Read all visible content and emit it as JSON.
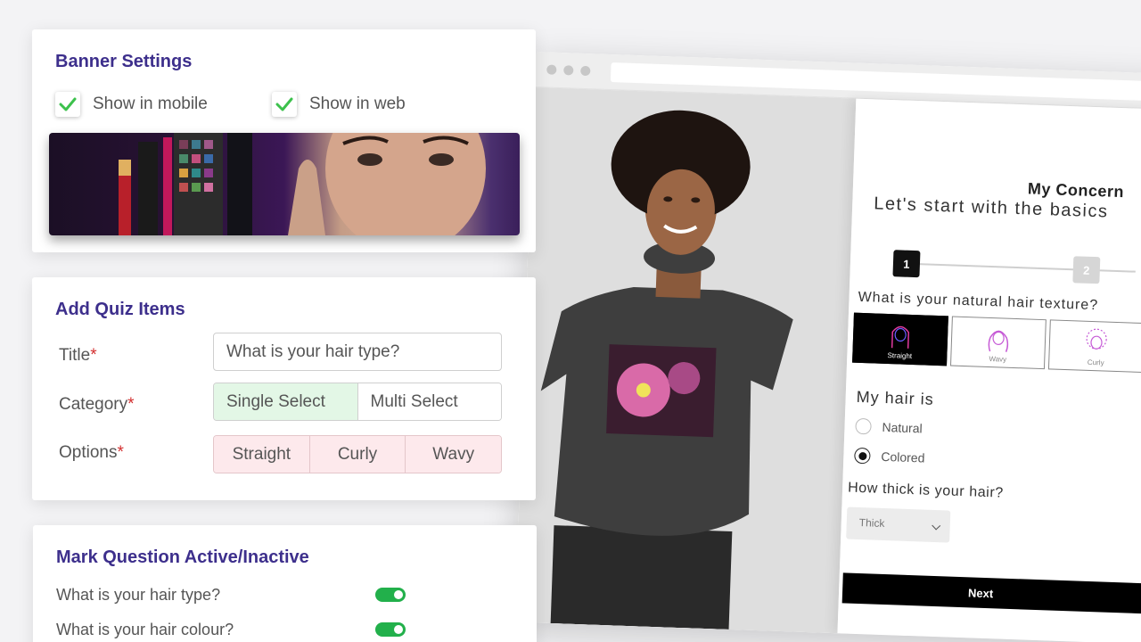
{
  "banner_settings": {
    "title": "Banner Settings",
    "show_mobile_label": "Show in mobile",
    "show_web_label": "Show in web",
    "show_mobile_checked": true,
    "show_web_checked": true
  },
  "add_quiz": {
    "title": "Add Quiz Items",
    "title_label": "Title",
    "category_label": "Category",
    "options_label": "Options",
    "required_mark": "*",
    "title_value": "What is your hair type?",
    "category_options": [
      "Single Select",
      "Multi Select"
    ],
    "category_selected": "Single Select",
    "options": [
      "Straight",
      "Curly",
      "Wavy"
    ]
  },
  "mark_active": {
    "title": "Mark Question Active/Inactive",
    "questions": [
      {
        "label": "What is your hair type?",
        "active": true
      },
      {
        "label": "What is your hair colour?",
        "active": true
      }
    ]
  },
  "preview": {
    "quiz_title": "My Concern",
    "quiz_subtitle": "Let's start with the basics",
    "steps": [
      "1",
      "2"
    ],
    "question": "What is your natural hair texture?",
    "textures": [
      "Straight",
      "Wavy",
      "Curly"
    ],
    "texture_selected": "Straight",
    "hair_is_label": "My hair is",
    "hair_options": [
      "Natural",
      "Colored"
    ],
    "hair_selected": "Colored",
    "thickness_question": "How thick is your hair?",
    "thickness_value": "Thick",
    "next_label": "Next"
  },
  "colors": {
    "card_title": "#3d2f8c",
    "toggle_on": "#22b04b",
    "check": "#3cc14c",
    "segment_selected": "#e3f7e6",
    "option_chip": "#fde9ec"
  }
}
